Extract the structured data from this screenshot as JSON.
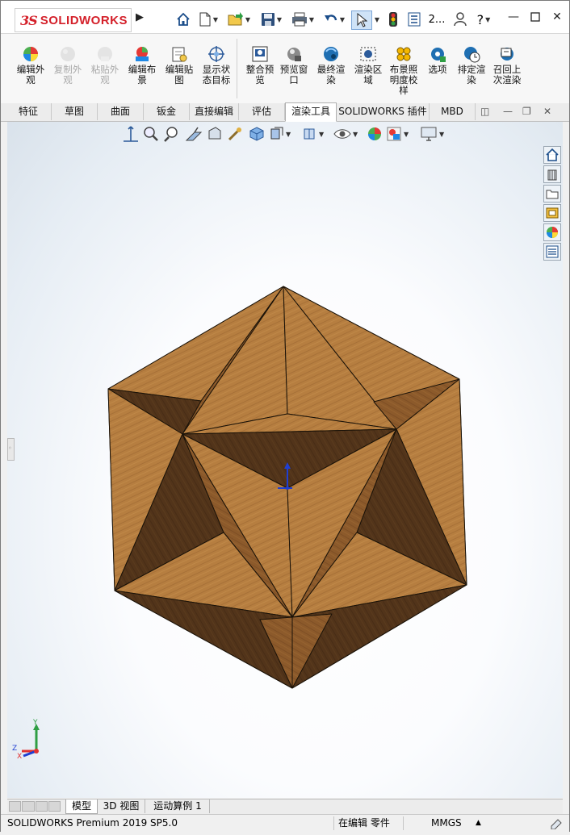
{
  "titlebar": {
    "logo_ds": "3S",
    "logo_text": "SOLIDWORKS",
    "doc_title_short": "2...",
    "help_label": "?",
    "window_controls": {
      "minimize": "minimize-icon",
      "maximize": "maximize-icon",
      "close": "close-icon"
    }
  },
  "ribbon": {
    "buttons": [
      {
        "label": "编辑外观",
        "icon": "edit-appearance-icon",
        "enabled": true
      },
      {
        "label": "复制外观",
        "icon": "copy-appearance-icon",
        "enabled": false
      },
      {
        "label": "粘贴外观",
        "icon": "paste-appearance-icon",
        "enabled": false
      },
      {
        "label": "编辑布景",
        "icon": "edit-scene-icon",
        "enabled": true
      },
      {
        "label": "编辑贴图",
        "icon": "edit-decal-icon",
        "enabled": true
      },
      {
        "label": "显示状态目标",
        "icon": "display-state-target-icon",
        "enabled": true
      },
      {
        "label": "整合预览",
        "icon": "integrated-preview-icon",
        "enabled": true
      },
      {
        "label": "预览窗口",
        "icon": "preview-window-icon",
        "enabled": true
      },
      {
        "label": "最终渲染",
        "icon": "final-render-icon",
        "enabled": true
      },
      {
        "label": "渲染区域",
        "icon": "render-region-icon",
        "enabled": true
      },
      {
        "label": "布景照明度校样",
        "icon": "scene-illumination-proof-icon",
        "enabled": true
      },
      {
        "label": "选项",
        "icon": "options-icon",
        "enabled": true
      },
      {
        "label": "排定渲染",
        "icon": "schedule-render-icon",
        "enabled": true
      },
      {
        "label": "召回上次渲染",
        "icon": "recall-last-render-icon",
        "enabled": true
      }
    ]
  },
  "tabs": [
    {
      "label": "特征"
    },
    {
      "label": "草图"
    },
    {
      "label": "曲面"
    },
    {
      "label": "钣金"
    },
    {
      "label": "直接编辑"
    },
    {
      "label": "评估"
    },
    {
      "label": "渲染工具",
      "active": true
    },
    {
      "label": "SOLIDWORKS 插件"
    },
    {
      "label": "MBD"
    }
  ],
  "task_pane": [
    "home-icon",
    "design-library-icon",
    "file-explorer-icon",
    "view-palette-icon",
    "appearances-icon",
    "custom-properties-icon"
  ],
  "bottom_tabs": [
    {
      "label": "模型",
      "active": true
    },
    {
      "label": "3D 视图"
    },
    {
      "label": "运动算例 1"
    }
  ],
  "status": {
    "product": "SOLIDWORKS Premium 2019 SP5.0",
    "editing": "在编辑 零件",
    "units": "MMGS",
    "units_caret": "▲"
  },
  "triad": {
    "x": "X",
    "y": "Y",
    "z": "Z"
  },
  "colors": {
    "wood_light": "#b07a3f",
    "wood_dark": "#4a2f18",
    "accent_red": "#d4202a",
    "origin_blue": "#1f3fd1"
  }
}
